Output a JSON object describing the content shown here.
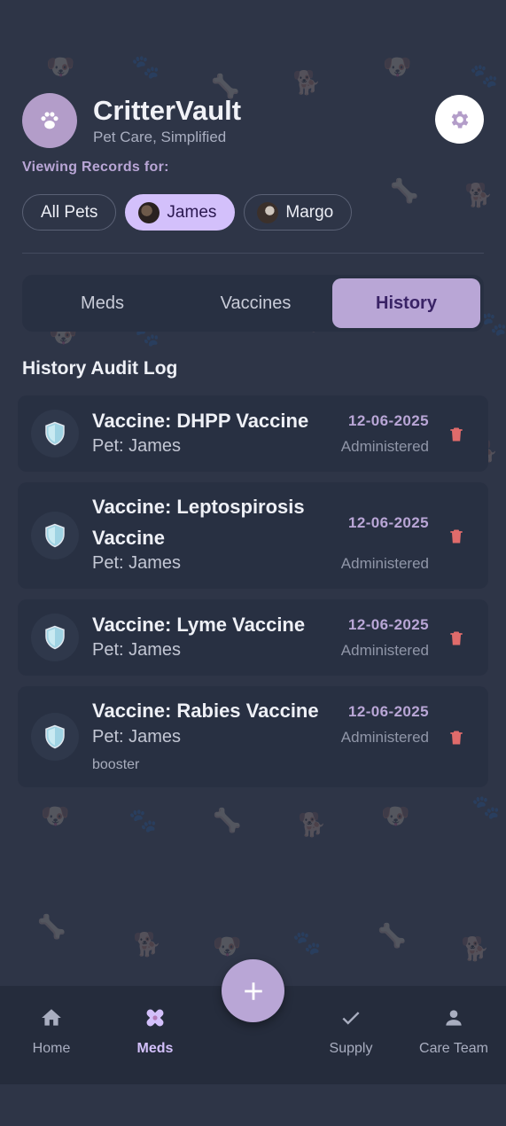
{
  "app": {
    "name": "CritterVault",
    "tagline": "Pet Care, Simplified",
    "viewing_label": "Viewing Records for:"
  },
  "pets": [
    {
      "label": "All Pets",
      "active": false
    },
    {
      "label": "James",
      "active": true
    },
    {
      "label": "Margo",
      "active": false
    }
  ],
  "tabs": [
    {
      "label": "Meds",
      "active": false
    },
    {
      "label": "Vaccines",
      "active": false
    },
    {
      "label": "History",
      "active": true
    }
  ],
  "section_title": "History Audit Log",
  "history": [
    {
      "title": "Vaccine: DHPP Vaccine",
      "pet": "Pet: James",
      "date": "12-06-2025",
      "status": "Administered",
      "notes": ""
    },
    {
      "title": "Vaccine: Leptospirosis Vaccine",
      "pet": "Pet: James",
      "date": "12-06-2025",
      "status": "Administered",
      "notes": ""
    },
    {
      "title": "Vaccine: Lyme Vaccine",
      "pet": "Pet: James",
      "date": "12-06-2025",
      "status": "Administered",
      "notes": ""
    },
    {
      "title": "Vaccine: Rabies Vaccine",
      "pet": "Pet: James",
      "date": "12-06-2025",
      "status": "Administered",
      "notes": "booster"
    }
  ],
  "nav": [
    {
      "label": "Home",
      "icon": "home-icon",
      "active": false
    },
    {
      "label": "Meds",
      "icon": "bandage-icon",
      "active": true
    },
    {
      "label": "Supply",
      "icon": "check-icon",
      "active": false
    },
    {
      "label": "Care Team",
      "icon": "person-icon",
      "active": false
    }
  ],
  "fab_icon": "plus-icon",
  "colors": {
    "background": "#2e3547",
    "accent": "#b9a6d6",
    "chip_active": "#d3c0fb",
    "card": "#283042",
    "delete": "#e06b6b"
  }
}
